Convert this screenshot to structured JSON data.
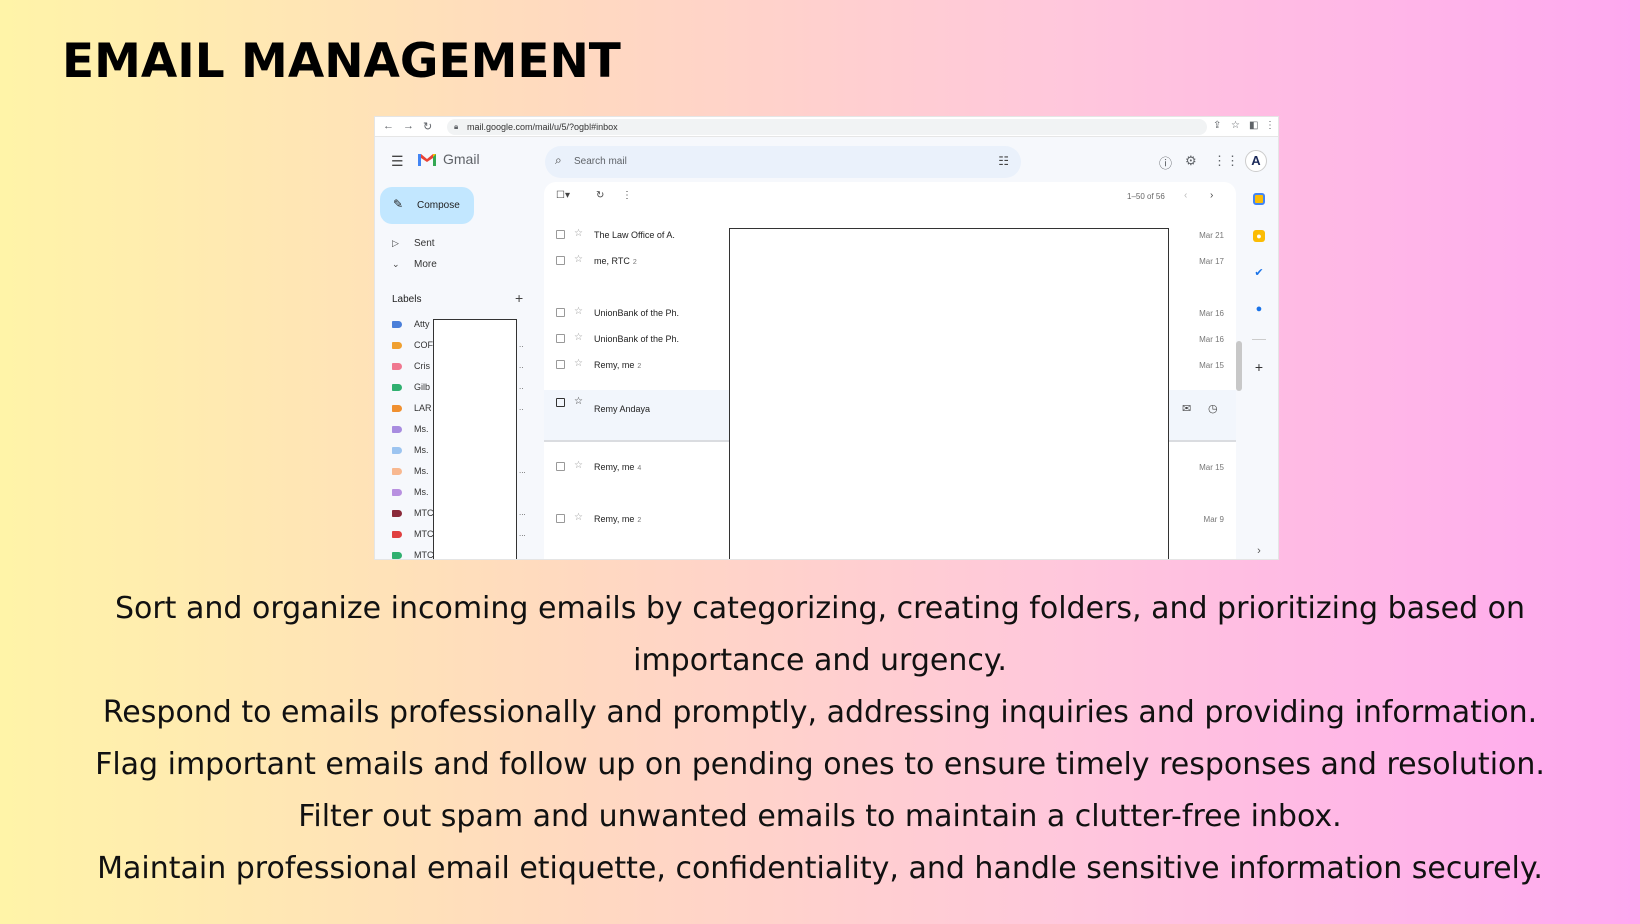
{
  "slide": {
    "title": "EMAIL MANAGEMENT",
    "lines": [
      "Sort and organize incoming emails by categorizing, creating folders, and prioritizing based on importance and urgency.",
      "Respond to emails professionally and promptly, addressing inquiries and providing information.",
      "Flag important emails and follow up on pending ones to ensure timely responses and resolution.",
      "Filter out spam and unwanted emails to maintain a clutter-free inbox.",
      "Maintain professional email etiquette, confidentiality, and handle sensitive information securely."
    ]
  },
  "browser": {
    "url": "mail.google.com/mail/u/5/?ogbl#inbox"
  },
  "gmail": {
    "brand": "Gmail",
    "search_placeholder": "Search mail",
    "compose_label": "Compose",
    "nav": [
      {
        "label": "Sent",
        "icon": "send-icon"
      },
      {
        "label": "More",
        "icon": "chevron-down-icon"
      }
    ],
    "labels_heading": "Labels",
    "labels": [
      {
        "text": "Atty",
        "color": "#4a7fd9"
      },
      {
        "text": "COF",
        "color": "#f0a030"
      },
      {
        "text": "Cris",
        "color": "#f07890"
      },
      {
        "text": "Gilb",
        "color": "#30b070"
      },
      {
        "text": "LAR",
        "color": "#f09030"
      },
      {
        "text": "Ms.",
        "color": "#a88ce0"
      },
      {
        "text": "Ms.",
        "color": "#9cc4f0"
      },
      {
        "text": "Ms.",
        "color": "#f8b890"
      },
      {
        "text": "Ms.",
        "color": "#b890e0"
      },
      {
        "text": "MTC",
        "color": "#8a2a3a"
      },
      {
        "text": "MTC",
        "color": "#e04040"
      },
      {
        "text": "MTC",
        "color": "#30b070"
      }
    ],
    "page_count": "1–50 of 56",
    "emails": [
      {
        "sender": "The Law Office of A.",
        "count": "",
        "date": "Mar 21"
      },
      {
        "sender": "me, RTC",
        "count": "2",
        "date": "Mar 17"
      },
      {
        "sender": "UnionBank of the Ph.",
        "count": "",
        "date": "Mar 16"
      },
      {
        "sender": "UnionBank of the Ph.",
        "count": "",
        "date": "Mar 16"
      },
      {
        "sender": "Remy, me",
        "count": "2",
        "date": "Mar 15"
      },
      {
        "sender": "Remy Andaya",
        "count": "",
        "date": ""
      },
      {
        "sender": "Remy, me",
        "count": "4",
        "date": "Mar 15"
      },
      {
        "sender": "Remy, me",
        "count": "2",
        "date": "Mar 9"
      }
    ],
    "colors": {
      "compose_bg": "#c2e7ff",
      "search_bg": "#eaf1fb",
      "panel_bg": "#f6f8fc"
    }
  }
}
